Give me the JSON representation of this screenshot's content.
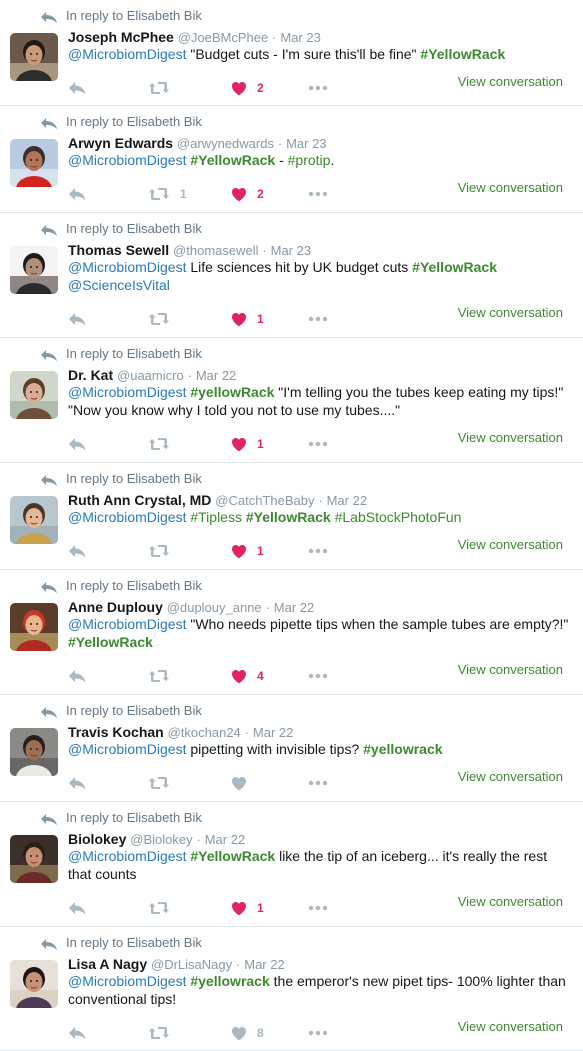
{
  "colors": {
    "link": "#3b8a2f",
    "liked": "#e0245e",
    "muted": "#aab8c2"
  },
  "tweets": [
    {
      "context": "In reply to Elisabeth Bik",
      "name": "Joseph McPhee",
      "handle": "@JoeBMcPhee",
      "date": "Mar 23",
      "text": [
        {
          "t": "m",
          "v": "@MicrobiomDigest"
        },
        {
          "t": "x",
          "v": " \"Budget cuts - I'm sure this'll be fine\" "
        },
        {
          "t": "h",
          "v": "#YellowRack"
        }
      ],
      "retweets": "",
      "likes": "2",
      "liked": true,
      "view_label": "View conversation",
      "avatar": "photo-man-dark-hair"
    },
    {
      "context": "In reply to Elisabeth Bik",
      "name": "Arwyn Edwards",
      "handle": "@arwynedwards",
      "date": "Mar 23",
      "text": [
        {
          "t": "m",
          "v": "@MicrobiomDigest"
        },
        {
          "t": "x",
          "v": " "
        },
        {
          "t": "h",
          "v": "#YellowRack"
        },
        {
          "t": "x",
          "v": " - "
        },
        {
          "t": "hn",
          "v": "#protip"
        },
        {
          "t": "x",
          "v": "."
        }
      ],
      "retweets": "1",
      "likes": "2",
      "liked": true,
      "view_label": "View conversation",
      "avatar": "photo-glacier-red-jacket"
    },
    {
      "context": "In reply to Elisabeth Bik",
      "name": "Thomas Sewell",
      "handle": "@thomasewell",
      "date": "Mar 23",
      "text": [
        {
          "t": "m",
          "v": "@MicrobiomDigest"
        },
        {
          "t": "x",
          "v": " Life sciences hit by UK budget cuts "
        },
        {
          "t": "h",
          "v": "#YellowRack"
        },
        {
          "t": "x",
          "v": " "
        },
        {
          "t": "m",
          "v": "@ScienceIsVital"
        }
      ],
      "retweets": "",
      "likes": "1",
      "liked": true,
      "view_label": "View conversation",
      "avatar": "photo-bearded-man"
    },
    {
      "context": "In reply to Elisabeth Bik",
      "name": "Dr. Kat",
      "handle": "@uaamicro",
      "date": "Mar 22",
      "text": [
        {
          "t": "m",
          "v": "@MicrobiomDigest"
        },
        {
          "t": "x",
          "v": " "
        },
        {
          "t": "h",
          "v": "#yellowRack"
        },
        {
          "t": "x",
          "v": " \"I'm telling you the tubes keep eating my tips!\" \"Now you know why I told you not to use my tubes....\""
        }
      ],
      "retweets": "",
      "likes": "1",
      "liked": true,
      "view_label": "View conversation",
      "avatar": "photo-woman-long-hair"
    },
    {
      "context": "In reply to Elisabeth Bik",
      "name": "Ruth Ann Crystal, MD",
      "handle": "@CatchTheBaby",
      "date": "Mar 22",
      "text": [
        {
          "t": "m",
          "v": "@MicrobiomDigest"
        },
        {
          "t": "x",
          "v": " "
        },
        {
          "t": "hn",
          "v": "#Tipless"
        },
        {
          "t": "x",
          "v": " "
        },
        {
          "t": "h",
          "v": "#YellowRack"
        },
        {
          "t": "x",
          "v": " "
        },
        {
          "t": "hn",
          "v": "#LabStockPhotoFun"
        }
      ],
      "retweets": "",
      "likes": "1",
      "liked": true,
      "view_label": "View conversation",
      "avatar": "photo-smiling-woman"
    },
    {
      "context": "In reply to Elisabeth Bik",
      "name": "Anne Duplouy",
      "handle": "@duplouy_anne",
      "date": "Mar 22",
      "text": [
        {
          "t": "m",
          "v": "@MicrobiomDigest"
        },
        {
          "t": "x",
          "v": " \"Who needs pipette tips when the sample tubes are empty?!\" "
        },
        {
          "t": "h",
          "v": "#YellowRack"
        }
      ],
      "retweets": "",
      "likes": "4",
      "liked": true,
      "view_label": "View conversation",
      "avatar": "photo-red-hood"
    },
    {
      "context": "In reply to Elisabeth Bik",
      "name": "Travis Kochan",
      "handle": "@tkochan24",
      "date": "Mar 22",
      "text": [
        {
          "t": "m",
          "v": "@MicrobiomDigest"
        },
        {
          "t": "x",
          "v": " pipetting with invisible tips? "
        },
        {
          "t": "h",
          "v": "#yellowrack"
        }
      ],
      "retweets": "",
      "likes": "",
      "liked": false,
      "view_label": "View conversation",
      "avatar": "photo-man-white-shirt"
    },
    {
      "context": "In reply to Elisabeth Bik",
      "name": "Biolokey",
      "handle": "@Biolokey",
      "date": "Mar 22",
      "text": [
        {
          "t": "m",
          "v": "@MicrobiomDigest"
        },
        {
          "t": "x",
          "v": " "
        },
        {
          "t": "h",
          "v": "#YellowRack"
        },
        {
          "t": "x",
          "v": " like the tip of an iceberg... it's really the rest that counts"
        }
      ],
      "retweets": "",
      "likes": "1",
      "liked": true,
      "view_label": "View conversation",
      "avatar": "photo-woman-bookshelf"
    },
    {
      "context": "In reply to Elisabeth Bik",
      "name": "Lisa A Nagy",
      "handle": "@DrLisaNagy",
      "date": "Mar 22",
      "text": [
        {
          "t": "m",
          "v": "@MicrobiomDigest"
        },
        {
          "t": "x",
          "v": " "
        },
        {
          "t": "h",
          "v": "#yellowrack"
        },
        {
          "t": "x",
          "v": " the emperor's new pipet tips- 100% lighter than conventional tips!"
        }
      ],
      "retweets": "",
      "likes": "8",
      "liked": false,
      "view_label": "View conversation",
      "avatar": "photo-dark-hair-woman"
    }
  ]
}
